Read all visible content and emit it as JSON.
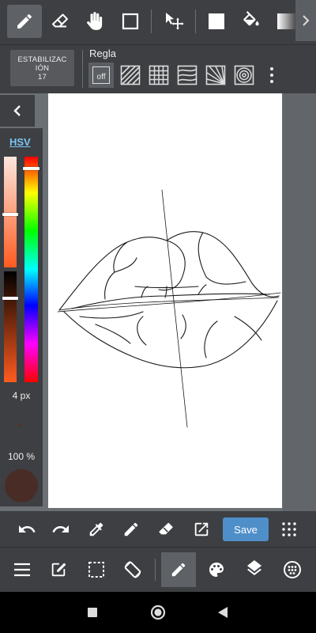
{
  "top_toolbar": {
    "tools": [
      {
        "icon": "pen-icon",
        "active": true
      },
      {
        "icon": "eraser-icon",
        "active": false
      },
      {
        "icon": "hand-icon",
        "active": false
      },
      {
        "icon": "square-shape-icon",
        "active": false
      },
      {
        "icon": "move-select-icon",
        "active": false
      },
      {
        "icon": "fill-color-icon",
        "active": false
      },
      {
        "icon": "bucket-icon",
        "active": false
      },
      {
        "icon": "gradient-icon",
        "active": false
      }
    ],
    "more_icon": "chevron-right-icon"
  },
  "stabilizer": {
    "line1": "ESTABILIZAC",
    "line2": "IÓN",
    "value": "17"
  },
  "ruler": {
    "label": "Regla",
    "off_label": "off",
    "options": [
      "off",
      "parallel-ruler",
      "grid-ruler",
      "curved-ruler",
      "radial-ruler",
      "concentric-ruler"
    ],
    "selected": "off"
  },
  "color_panel": {
    "mode_label": "HSV",
    "brush_size": "4 px",
    "opacity": "100 %",
    "current_color": "#4a2c26"
  },
  "action_bar": {
    "save_label": "Save",
    "accent": "#4f8fc9"
  },
  "bottom_menu": {
    "items": [
      "menu-icon",
      "edit-icon",
      "selection-icon",
      "rotate-icon",
      "brush-icon",
      "palette-icon",
      "layers-icon",
      "materials-icon"
    ],
    "active": "brush-icon"
  },
  "colors": {
    "toolbar_bg": "#3d3f42",
    "workspace_bg": "#6b7075",
    "canvas_bg": "#ffffff"
  }
}
